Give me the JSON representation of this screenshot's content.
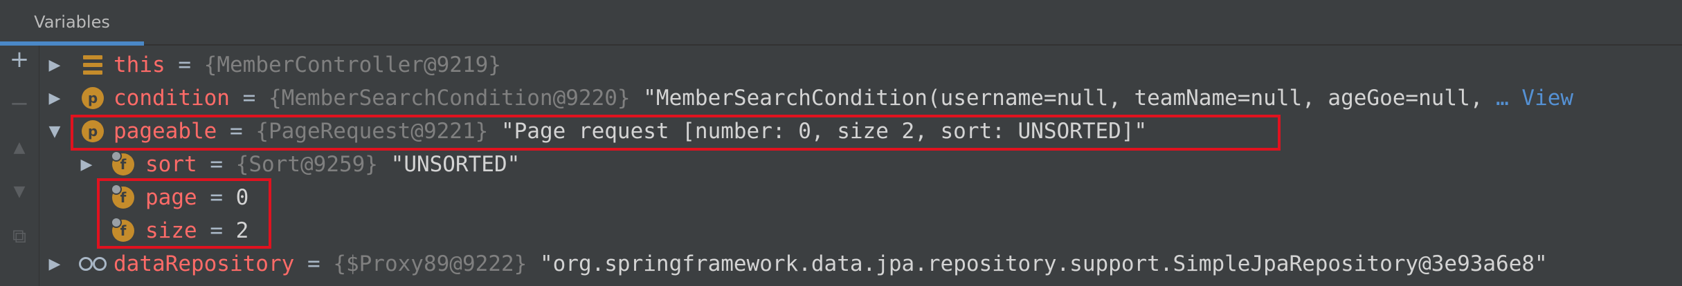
{
  "panel": {
    "tab_label": "Variables"
  },
  "toolbar": {
    "buttons": [
      {
        "icon": "plus-icon",
        "glyph": "+"
      },
      {
        "icon": "minus-icon",
        "glyph": "−"
      },
      {
        "icon": "arrow-up-icon",
        "glyph": "▲"
      },
      {
        "icon": "arrow-down-icon",
        "glyph": "▼"
      },
      {
        "icon": "copy-icon",
        "glyph": "⧉"
      }
    ]
  },
  "variables": [
    {
      "name": "this",
      "eq": "=",
      "ref": "{MemberController@9219}",
      "value": "",
      "icon": "stack-icon",
      "expanded": false
    },
    {
      "name": "condition",
      "eq": "=",
      "ref": "{MemberSearchCondition@9220}",
      "value": "\"MemberSearchCondition(username=null, teamName=null, ageGoe=null,",
      "more": "… View",
      "icon": "p-icon",
      "expanded": false
    },
    {
      "name": "pageable",
      "eq": "=",
      "ref": "{PageRequest@9221}",
      "value": "\"Page request [number: 0, size 2, sort: UNSORTED]\"",
      "icon": "p-icon",
      "expanded": true,
      "children": [
        {
          "name": "sort",
          "eq": "=",
          "ref": "{Sort@9259}",
          "value": "\"UNSORTED\"",
          "icon": "f-icon",
          "expandable": true
        },
        {
          "name": "page",
          "eq": "=",
          "ref": "",
          "value": "0",
          "icon": "f-icon",
          "expandable": false
        },
        {
          "name": "size",
          "eq": "=",
          "ref": "",
          "value": "2",
          "icon": "f-icon",
          "expandable": false
        }
      ]
    },
    {
      "name": "dataRepository",
      "eq": "=",
      "ref": "{$Proxy89@9222}",
      "value": "\"org.springframework.data.jpa.repository.support.SimpleJpaRepository@3e93a6e8\"",
      "icon": "glasses-icon",
      "expanded": false
    }
  ],
  "badges": {
    "p": "p",
    "f": "f"
  },
  "colors": {
    "background": "#3c3f41",
    "name": "#ff6b68",
    "reference": "#808080",
    "value": "#d4d4d4",
    "highlight": "#e0121f",
    "tab_underline": "#4a88c7",
    "link": "#5591d4"
  }
}
